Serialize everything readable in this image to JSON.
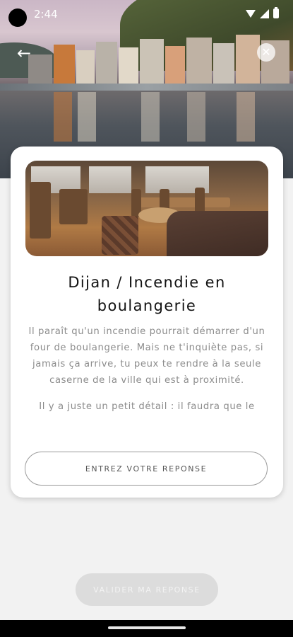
{
  "status_bar": {
    "time": "2:44"
  },
  "header": {
    "back_icon": "arrow-left-icon",
    "close_icon": "close-icon",
    "back_glyph": "←",
    "close_glyph": "✕"
  },
  "card": {
    "title": "Dijan / Incendie en boulangerie",
    "paragraph_1": "Il paraît qu'un incendie pourrait démarrer d'un four de boulangerie. Mais ne t'inquiète pas, si jamais ça arrive, tu peux te rendre à la seule caserne de la ville qui est à proximité.",
    "paragraph_2": "Il y a juste un petit détail : il faudra que le",
    "answer_placeholder": "ENTREZ VOTRE REPONSE"
  },
  "footer": {
    "validate_label": "VALIDER MA REPONSE"
  },
  "colors": {
    "card_bg": "#ffffff",
    "page_bg": "#f2f2f2",
    "button_disabled": "#dcdcdc"
  }
}
